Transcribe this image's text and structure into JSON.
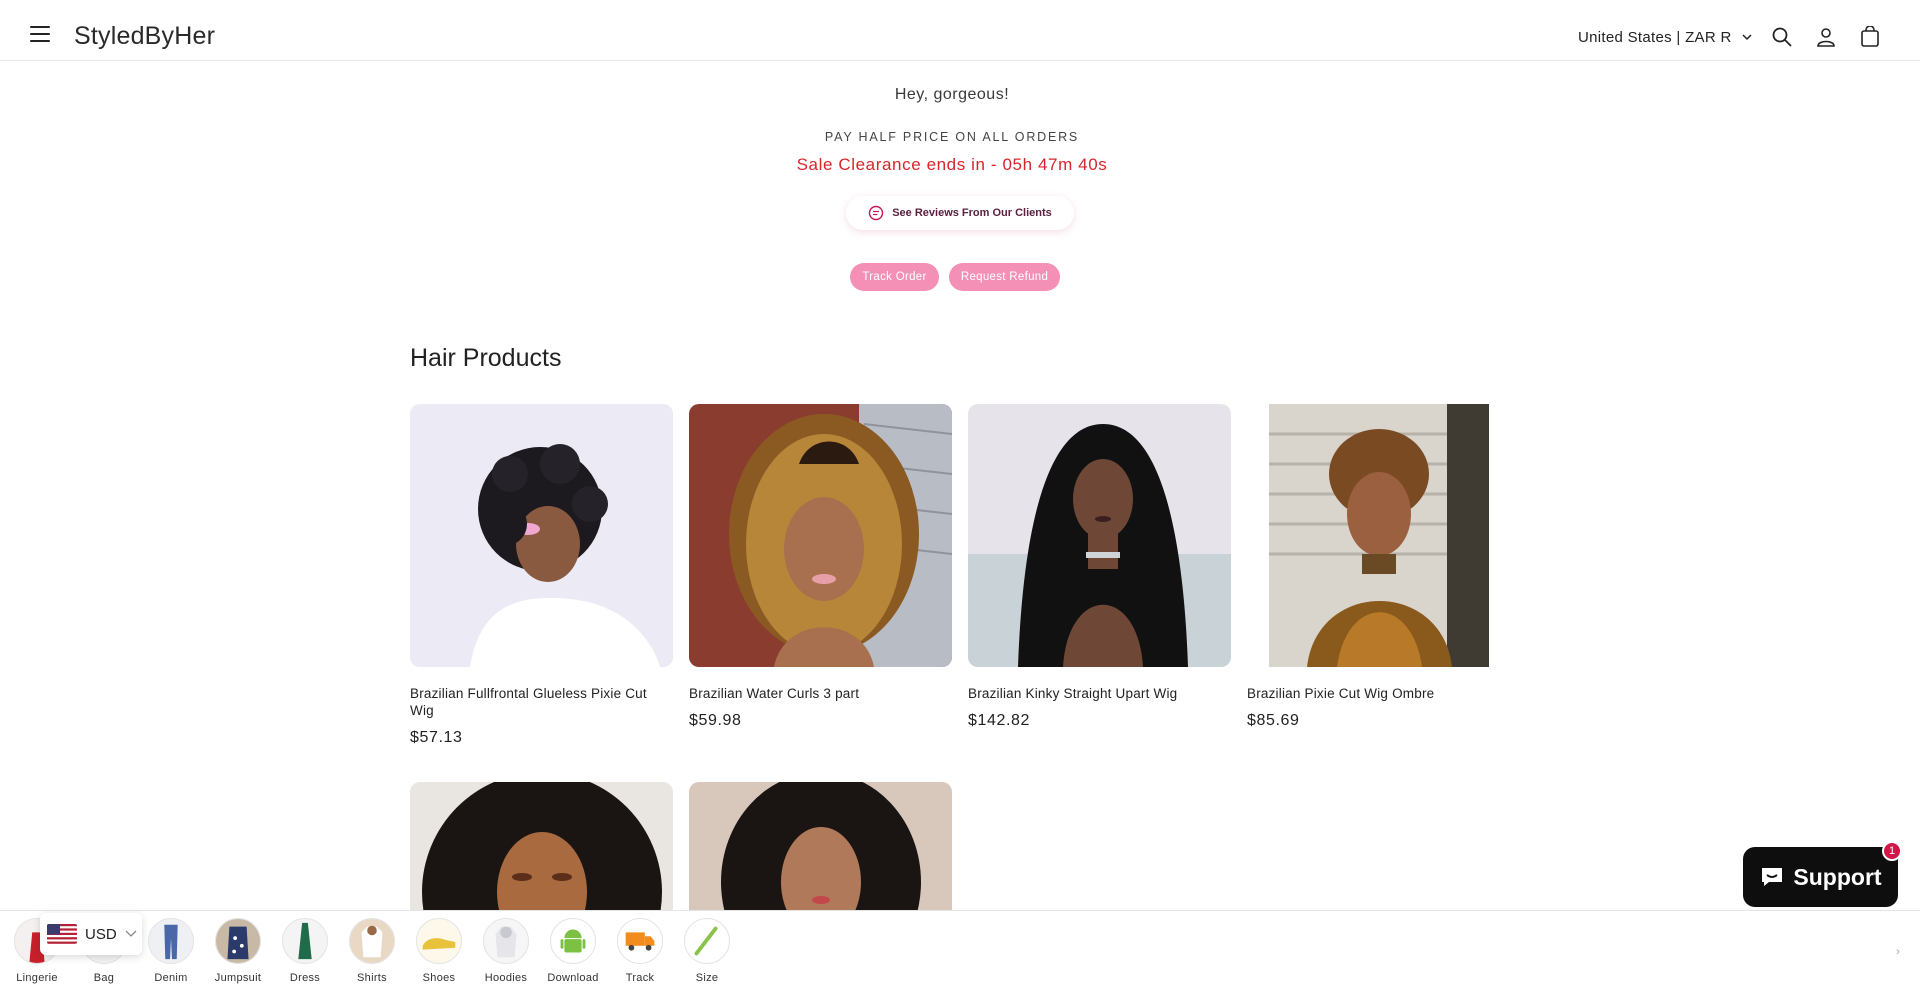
{
  "header": {
    "logo": "StyledByHer",
    "country_selector": "United States | ZAR R",
    "icons": [
      "menu-icon",
      "search-icon",
      "account-icon",
      "cart-icon"
    ]
  },
  "announcement": {
    "greeting": "Hey, gorgeous!",
    "promo": "PAY HALF PRICE ON ALL ORDERS",
    "countdown": "Sale Clearance ends in - 05h 47m 40s",
    "reviews_button": "See Reviews From Our Clients",
    "track_order": "Track Order",
    "request_refund": "Request Refund"
  },
  "collection": {
    "title": "Hair Products",
    "products": [
      {
        "title": "Brazilian Fullfrontal Glueless Pixie Cut Wig",
        "price": "$57.13"
      },
      {
        "title": "Brazilian Water Curls 3 part",
        "price": "$59.98"
      },
      {
        "title": "Brazilian Kinky Straight Upart Wig",
        "price": "$142.82"
      },
      {
        "title": "Brazilian Pixie Cut Wig Ombre",
        "price": "$85.69"
      }
    ]
  },
  "support": {
    "label": "Support",
    "badge": "1"
  },
  "currency": {
    "code": "USD"
  },
  "bottom_nav": [
    "Lingerie",
    "Bag",
    "Denim",
    "Jumpsuit",
    "Dress",
    "Shirts",
    "Shoes",
    "Hoodies",
    "Download",
    "Track",
    "Size"
  ],
  "colors": {
    "accent_pink": "#f48fb6",
    "countdown_red": "#d6262b",
    "support_bg": "#0e0e0e",
    "badge": "#d1174a"
  }
}
